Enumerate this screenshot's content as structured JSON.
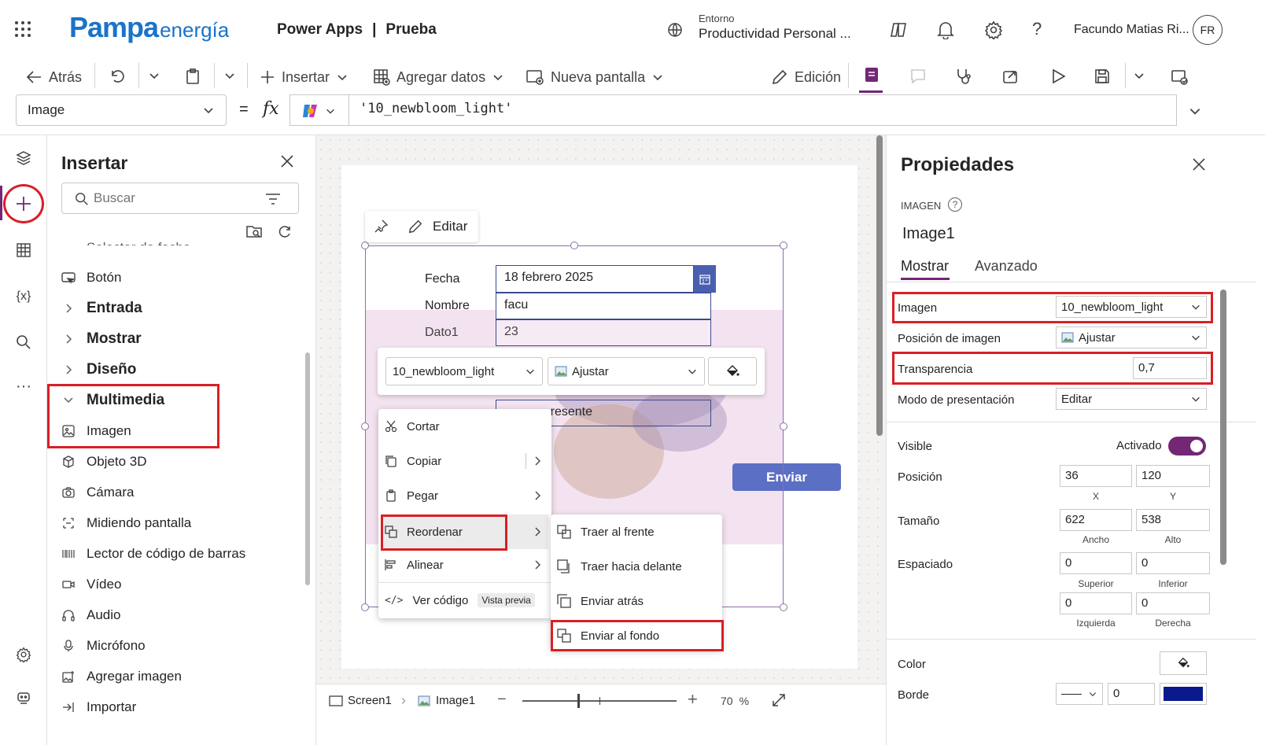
{
  "header": {
    "brand_main": "Pampa",
    "brand_sub": "energía",
    "app_title": "Power Apps",
    "separator": "|",
    "app_name": "Prueba",
    "env_label": "Entorno",
    "env_value": "Productividad Personal ...",
    "user_name": "Facundo Matias Ri...",
    "user_initials": "FR"
  },
  "toolbar": {
    "back": "Atrás",
    "insert": "Insertar",
    "add_data": "Agregar datos",
    "new_screen": "Nueva pantalla",
    "edit": "Edición"
  },
  "formula": {
    "property": "Image",
    "equals": "=",
    "fx": "fx",
    "value": "'10_newbloom_light'"
  },
  "insert_panel": {
    "title": "Insertar",
    "search_placeholder": "Buscar",
    "items": [
      {
        "label": "Selector de fecha",
        "icon": "calendar-icon"
      },
      {
        "label": "Botón",
        "icon": "button-icon"
      },
      {
        "label": "Entrada",
        "icon": "chevron-right-icon"
      },
      {
        "label": "Mostrar",
        "icon": "chevron-right-icon"
      },
      {
        "label": "Diseño",
        "icon": "chevron-right-icon"
      },
      {
        "label": "Multimedia",
        "icon": "chevron-down-icon"
      },
      {
        "label": "Imagen",
        "icon": "image-icon"
      },
      {
        "label": "Objeto 3D",
        "icon": "cube-icon"
      },
      {
        "label": "Cámara",
        "icon": "camera-icon"
      },
      {
        "label": "Midiendo pantalla",
        "icon": "measure-icon"
      },
      {
        "label": "Lector de código de barras",
        "icon": "barcode-icon"
      },
      {
        "label": "Vídeo",
        "icon": "video-icon"
      },
      {
        "label": "Audio",
        "icon": "headphones-icon"
      },
      {
        "label": "Micrófono",
        "icon": "microphone-icon"
      },
      {
        "label": "Agregar imagen",
        "icon": "add-image-icon"
      },
      {
        "label": "Importar",
        "icon": "import-icon"
      }
    ]
  },
  "canvas": {
    "edit_label": "Editar",
    "form": {
      "fields": [
        {
          "label": "Fecha",
          "value": "18 febrero 2025"
        },
        {
          "label": "Nombre",
          "value": "facu"
        },
        {
          "label": "Dato1",
          "value": "23"
        }
      ],
      "hidden_value_fragment": "resente",
      "submit": "Enviar"
    },
    "floating_toolbar": {
      "image_value": "10_newbloom_light",
      "position_value": "Ajustar"
    },
    "context_menu": {
      "items": [
        "Cortar",
        "Copiar",
        "Pegar",
        "Reordenar",
        "Alinear",
        "Ver código"
      ],
      "preview_badge": "Vista previa"
    },
    "submenu": {
      "items": [
        "Traer al frente",
        "Traer hacia delante",
        "Enviar atrás",
        "Enviar al fondo"
      ]
    }
  },
  "status_bar": {
    "screen": "Screen1",
    "image": "Image1",
    "zoom": "70",
    "zoom_unit": "%"
  },
  "properties": {
    "title": "Propiedades",
    "type": "IMAGEN",
    "name": "Image1",
    "tabs": [
      "Mostrar",
      "Avanzado"
    ],
    "image_label": "Imagen",
    "image_value": "10_newbloom_light",
    "position_label": "Posición de imagen",
    "position_value": "Ajustar",
    "transparency_label": "Transparencia",
    "transparency_value": "0,7",
    "display_mode_label": "Modo de presentación",
    "display_mode_value": "Editar",
    "visible_label": "Visible",
    "visible_value": "Activado",
    "visible_on": true,
    "pos_label": "Posición",
    "pos_x": "36",
    "pos_y": "120",
    "x_label": "X",
    "y_label": "Y",
    "size_label": "Tamaño",
    "width": "622",
    "height": "538",
    "width_label": "Ancho",
    "height_label": "Alto",
    "padding_label": "Espaciado",
    "pad_top": "0",
    "pad_bottom": "0",
    "pad_left": "0",
    "pad_right": "0",
    "top_label": "Superior",
    "bottom_label": "Inferior",
    "left_label": "Izquierda",
    "right_label": "Derecha",
    "color_label": "Color",
    "border_label": "Borde",
    "border_value": "0",
    "border_color": "#0a1a8c"
  },
  "colors": {
    "accent_purple": "#742774",
    "highlight_red": "#d91f26",
    "brand_blue": "#1a73c9",
    "button_blue": "#5b6fc4"
  }
}
